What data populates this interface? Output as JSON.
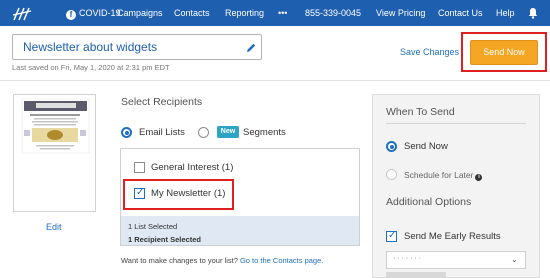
{
  "nav": {
    "items": [
      {
        "label": "COVID-19"
      },
      {
        "label": "Campaigns"
      },
      {
        "label": "Contacts"
      },
      {
        "label": "Reporting"
      },
      {
        "label": "•••"
      },
      {
        "label": "855-339-0045"
      },
      {
        "label": "View Pricing"
      },
      {
        "label": "Contact Us"
      },
      {
        "label": "Help"
      }
    ],
    "covid_icon": "f",
    "colors": {
      "background": "#1f5fb0",
      "text": "#ffffff"
    }
  },
  "campaign": {
    "name": "Newsletter about widgets",
    "last_saved": "Last saved on Fri, May 1, 2020 at 2:31 pm EDT"
  },
  "actions": {
    "save_changes": "Save Changes",
    "send_now": "Send Now"
  },
  "preview": {
    "edit_label": "Edit"
  },
  "recipients": {
    "title": "Select Recipients",
    "options": [
      {
        "label": "Email Lists",
        "selected": true
      },
      {
        "label": "Segments",
        "selected": false,
        "badge": "New"
      }
    ],
    "lists": [
      {
        "label": "General Interest (1)",
        "checked": false
      },
      {
        "label": "My Newsletter (1)",
        "checked": true
      }
    ],
    "summary": {
      "lists_selected": "1 List Selected",
      "recipients_selected": "1 Recipient Selected"
    },
    "help": {
      "text": "Want to make changes to your list?",
      "link": "Go to the Contacts page."
    }
  },
  "when_to_send": {
    "title": "When To Send",
    "options": [
      {
        "label": "Send Now",
        "selected": true
      },
      {
        "label": "Schedule for Later",
        "selected": false,
        "info_icon": "i"
      }
    ]
  },
  "additional_options": {
    "title": "Additional Options",
    "early_results": {
      "label": "Send Me Early Results",
      "checked": true
    }
  },
  "colors": {
    "accent": "#1f6fc0",
    "send_button": "#f5a623",
    "highlight_outline": "#e02020",
    "badge": "#2ea3c6"
  }
}
